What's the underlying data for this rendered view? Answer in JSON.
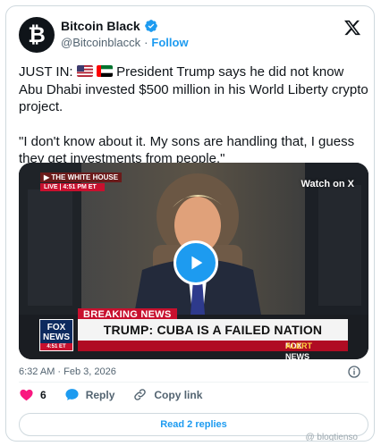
{
  "author": {
    "name": "Bitcoin Black",
    "handle": "@Bitcoinblacck",
    "separator": "·",
    "follow_label": "Follow",
    "avatar_letter": "₿"
  },
  "tweet": {
    "prefix": "JUST IN:",
    "line1_rest": "President Trump says he did not know Abu Dhabi invested $500 million in his World Liberty crypto project.",
    "quote": "\"I don't know about it. My sons are handling that, I guess they get investments from people.\""
  },
  "video": {
    "badge_top": "▶ THE WHITE HOUSE",
    "badge_live": "LIVE | 4:51 PM ET",
    "watch_on": "Watch on X",
    "breaking": "BREAKING NEWS",
    "headline": "TRUMP: CUBA IS A FAILED NATION",
    "alert_brand": "FOX NEWS",
    "alert_word": "ALERT",
    "fox_line1": "FOX",
    "fox_line2": "NEWS",
    "fox_time": "4:51 ET"
  },
  "footer": {
    "timestamp": "6:32 AM · Feb 3, 2026",
    "like_count": "6",
    "reply_label": "Reply",
    "copy_label": "Copy link",
    "read_replies": "Read 2 replies",
    "watermark": "@ blogtienso"
  },
  "colors": {
    "accent": "#1d9bf0",
    "like": "#f91880",
    "text": "#0f1419",
    "muted": "#536471",
    "fox_red": "#c8102e"
  },
  "icons": [
    "verified-badge-icon",
    "x-logo-icon",
    "us-flag-icon",
    "uae-flag-icon",
    "play-icon",
    "info-icon",
    "heart-icon",
    "reply-icon",
    "link-icon"
  ]
}
